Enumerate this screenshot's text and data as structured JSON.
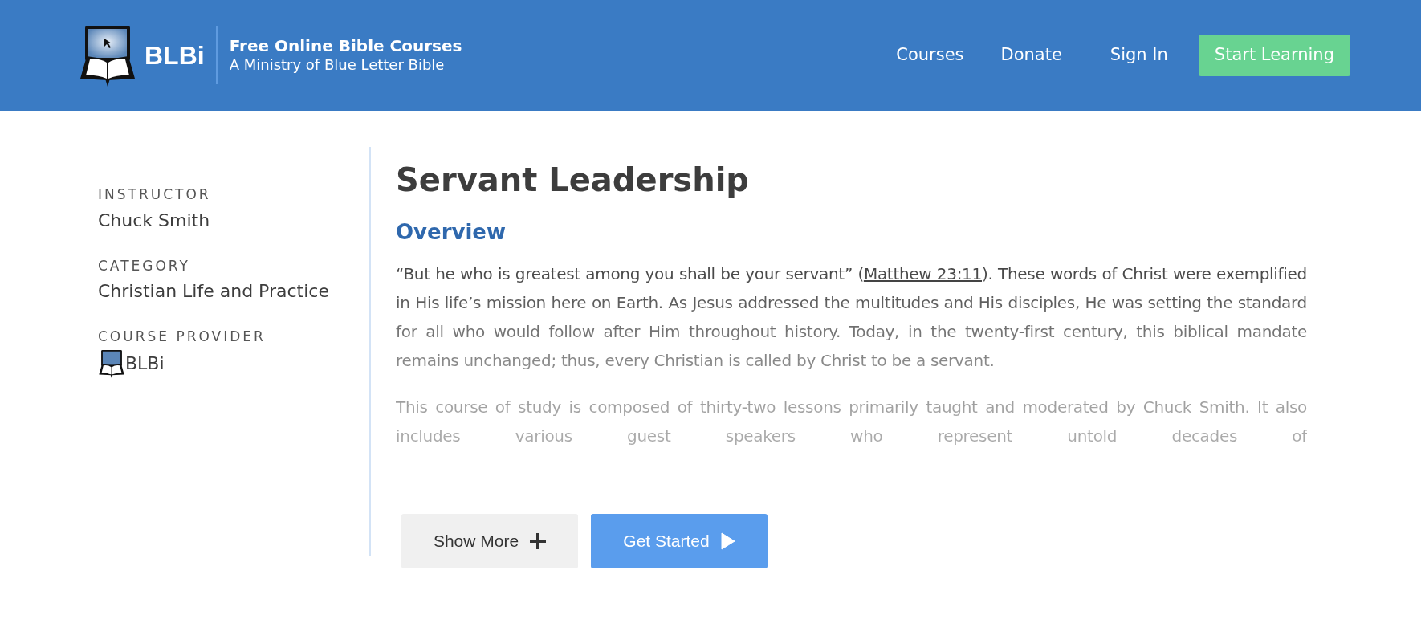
{
  "header": {
    "logo_text": "BLBi",
    "title": "Free Online Bible Courses",
    "subtitle": "A Ministry of Blue Letter Bible",
    "nav": [
      {
        "label": "Courses",
        "kind": "link"
      },
      {
        "label": "Donate",
        "kind": "link"
      },
      {
        "label": "Sign In",
        "kind": "link"
      },
      {
        "label": "Start Learning",
        "kind": "button"
      }
    ]
  },
  "sidebar": [
    {
      "label": "INSTRUCTOR",
      "value": "Chuck Smith",
      "kind": "text"
    },
    {
      "label": "CATEGORY",
      "value": "Christian Life and Practice",
      "kind": "text"
    },
    {
      "label": "COURSE PROVIDER",
      "value": "BLBi",
      "kind": "provider"
    }
  ],
  "main": {
    "title": "Servant Leadership",
    "heading": "Overview",
    "paragraphs": [
      [
        {
          "text": "“But he who is greatest among you shall be your servant” (",
          "kind": "text"
        },
        {
          "text": "Matthew 23:11",
          "kind": "link"
        },
        {
          "text": "). These words of Christ were exemplified in His life’s mission here on Earth. As Jesus addressed the multitudes and His disciples, He was setting the standard for all who would follow after Him throughout history. Today, in the twenty-first century, this biblical mandate remains unchanged; thus, every Christian is called by Christ to be a servant.",
          "kind": "text"
        }
      ],
      [
        {
          "text": "This course of study is composed of thirty-two lessons primarily taught and moderated by Chuck Smith. It also includes various guest speakers who represent untold decades of",
          "kind": "text"
        }
      ]
    ],
    "buttons": [
      {
        "label": "Show More",
        "kind": "secondary"
      },
      {
        "label": "Get Started",
        "kind": "primary"
      }
    ]
  }
}
